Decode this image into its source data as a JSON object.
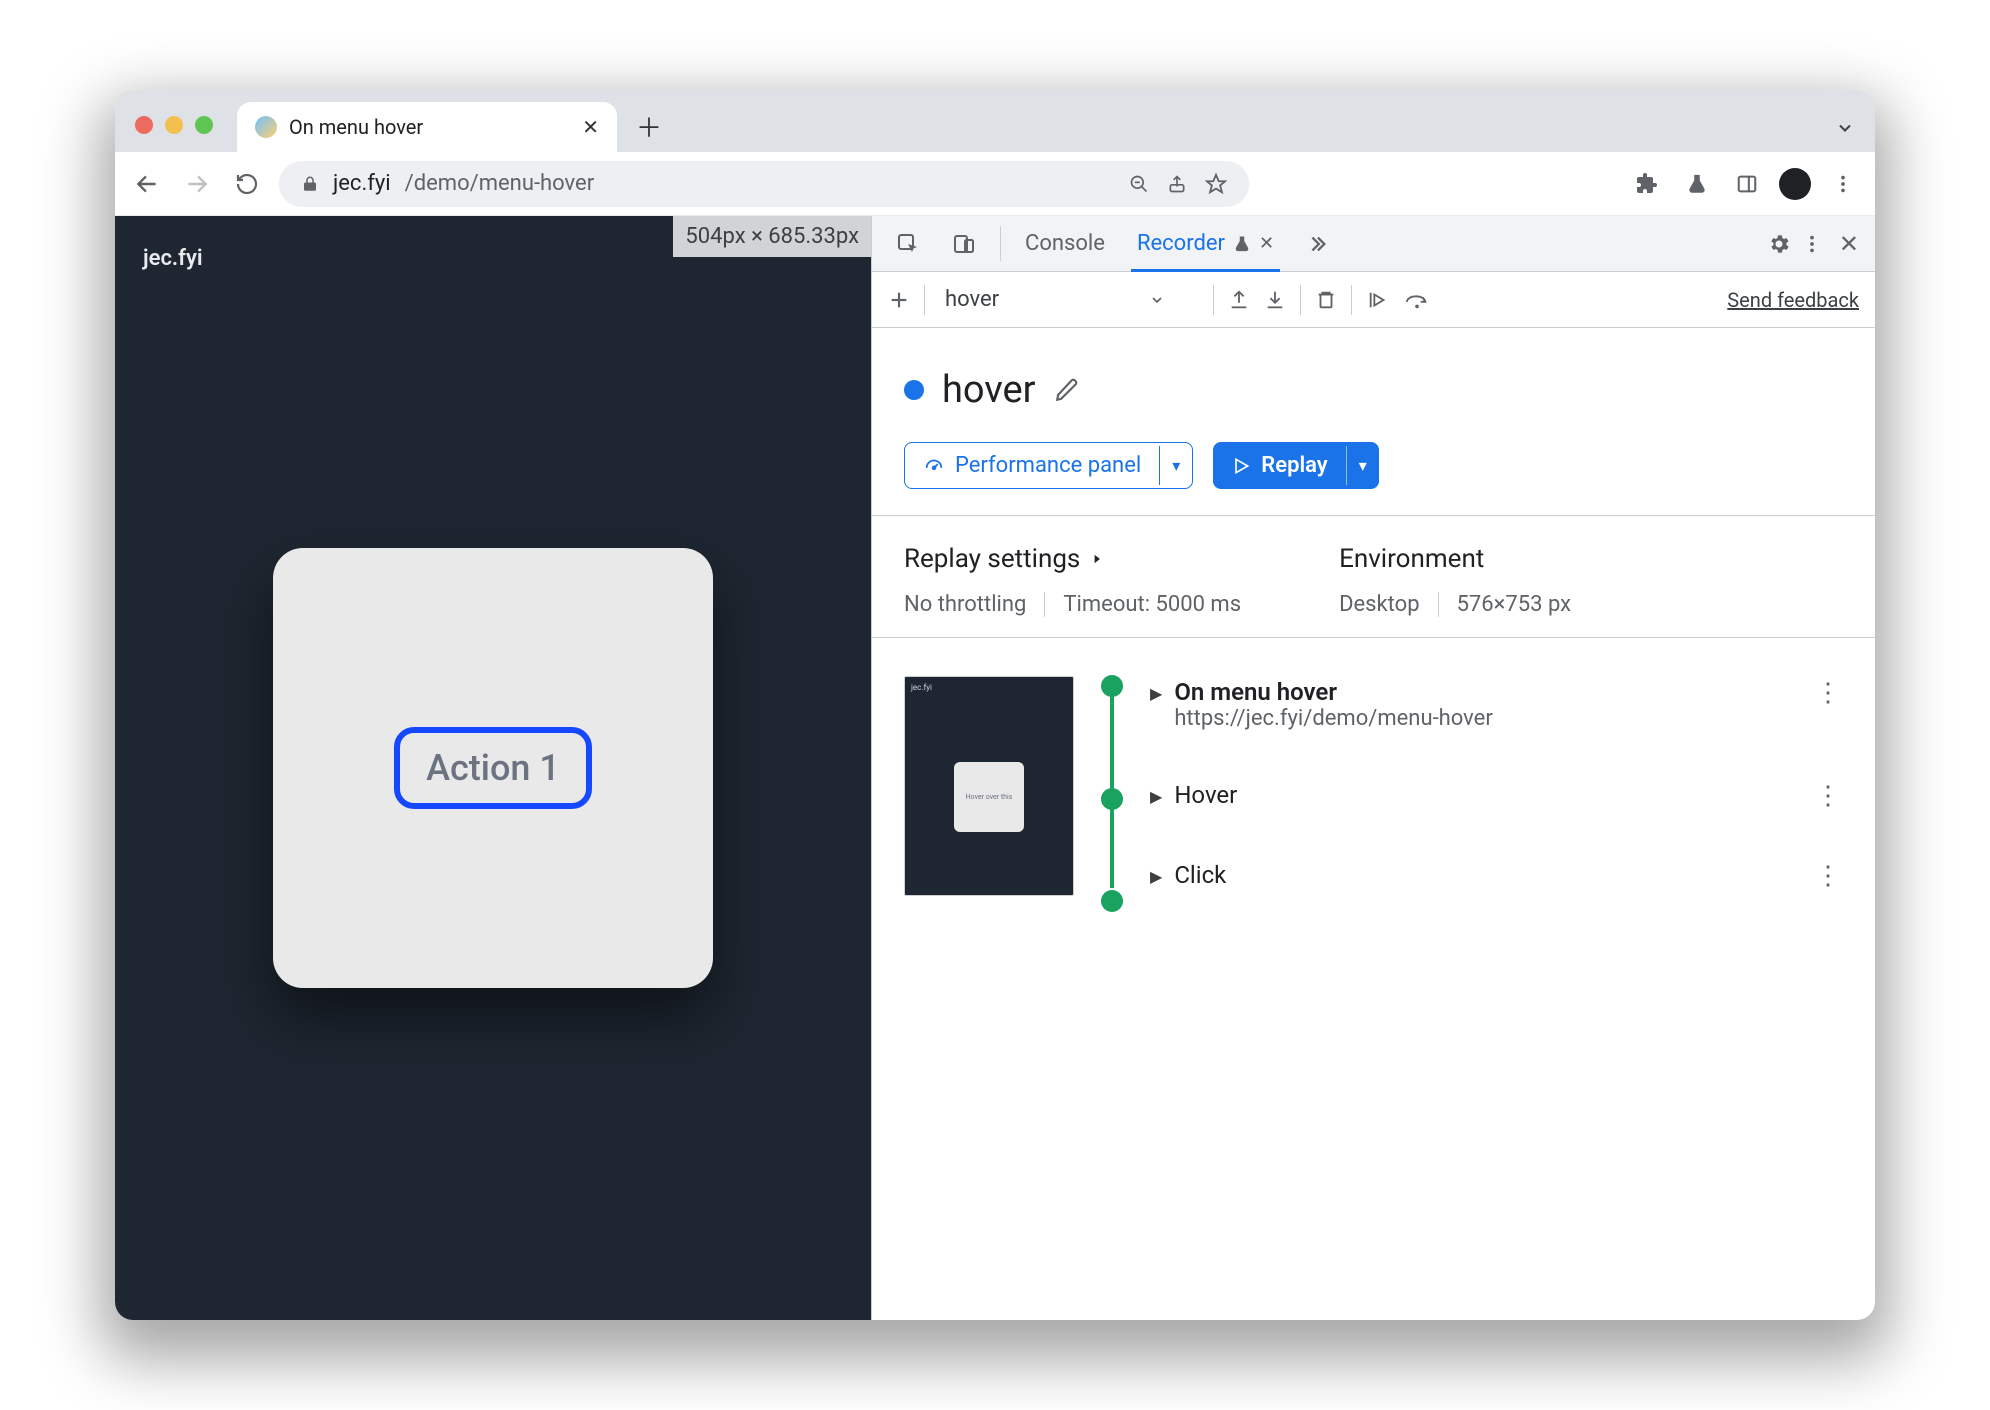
{
  "browser": {
    "tab_title": "On menu hover",
    "url_host": "jec.fyi",
    "url_path": "/demo/menu-hover"
  },
  "page": {
    "brand": "jec.fyi",
    "dimension_badge": "504px × 685.33px",
    "action_button": "Action 1"
  },
  "devtools": {
    "tabs": {
      "console": "Console",
      "recorder": "Recorder"
    },
    "recording_select": "hover",
    "feedback": "Send feedback",
    "title": "hover",
    "perf_button": "Performance panel",
    "replay_button": "Replay",
    "replay_settings_label": "Replay settings",
    "environment_label": "Environment",
    "throttling": "No throttling",
    "timeout": "Timeout: 5000 ms",
    "env_device": "Desktop",
    "env_size": "576×753 px",
    "steps": [
      {
        "label": "On menu hover",
        "sub": "https://jec.fyi/demo/menu-hover",
        "bold": true
      },
      {
        "label": "Hover"
      },
      {
        "label": "Click"
      }
    ],
    "thumb_text": "Hover over this"
  }
}
